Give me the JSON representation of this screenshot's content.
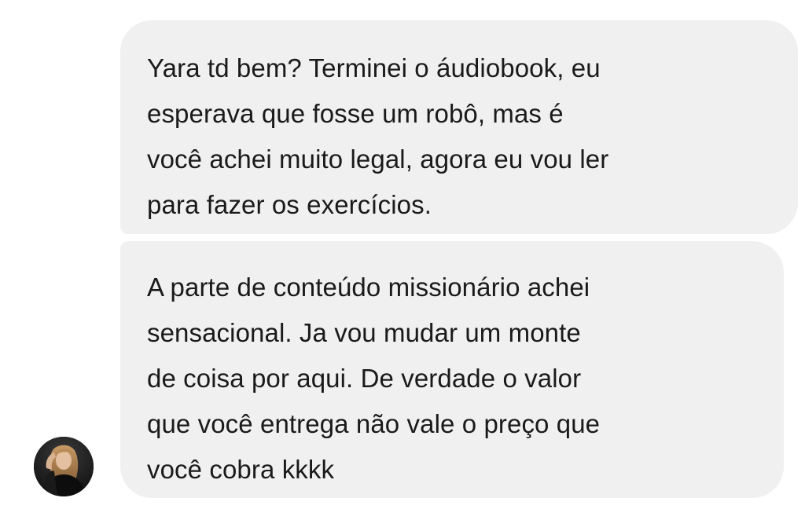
{
  "messages": [
    {
      "lines": [
        "Yara td bem? Terminei o áudiobook, eu",
        "esperava que fosse um robô, mas é",
        "você achei muito legal, agora eu vou ler",
        "para fazer os exercícios."
      ]
    },
    {
      "lines": [
        "A parte de conteúdo missionário achei",
        "sensacional. Ja vou mudar um monte",
        "de coisa por aqui. De verdade o valor",
        "que você entrega não vale o preço que",
        "você cobra kkkk"
      ]
    }
  ],
  "colors": {
    "bubble_background": "#f0f0f0",
    "text": "#1a1a1a",
    "page_background": "#ffffff"
  },
  "icons": {
    "avatar": "user-avatar-photo"
  }
}
